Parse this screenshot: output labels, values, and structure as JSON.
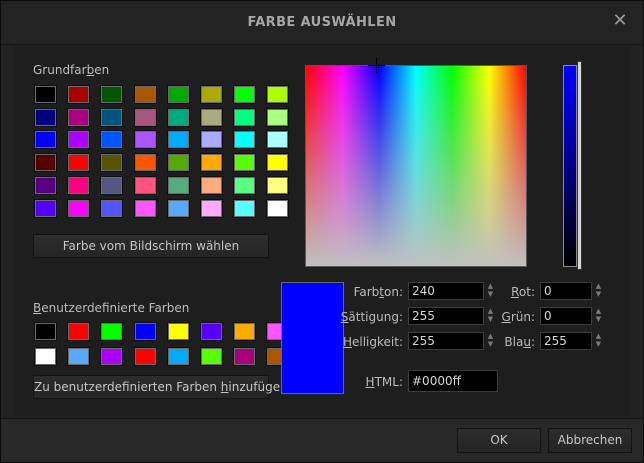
{
  "dialog": {
    "title": "FARBE AUSWÄHLEN",
    "close_symbol": "✕"
  },
  "basic_colors": {
    "label_before": "Grundfar",
    "label_underlined": "b",
    "label_after": "en",
    "swatches": [
      [
        "#000000",
        "#aa0000",
        "#005500",
        "#aa5500",
        "#00aa00",
        "#aaaa00",
        "#00ff00",
        "#aaff00"
      ],
      [
        "#00007f",
        "#aa007f",
        "#00557f",
        "#aa557f",
        "#00aa7f",
        "#aaaa7f",
        "#00ff7f",
        "#aaff7f"
      ],
      [
        "#0000ff",
        "#aa00ff",
        "#0055ff",
        "#aa55ff",
        "#00aaff",
        "#aaaaff",
        "#00ffff",
        "#aaffff"
      ],
      [
        "#550000",
        "#ff0000",
        "#555500",
        "#ff5500",
        "#55aa00",
        "#ffaa00",
        "#55ff00",
        "#ffff00"
      ],
      [
        "#55007f",
        "#ff007f",
        "#55557f",
        "#ff557f",
        "#55aa7f",
        "#ffaa7f",
        "#55ff7f",
        "#ffff7f"
      ],
      [
        "#5500ff",
        "#ff00ff",
        "#5555ff",
        "#ff55ff",
        "#55aaff",
        "#ffaaff",
        "#55ffff",
        "#ffffff"
      ]
    ]
  },
  "pick_screen_button": "Farbe vom Bildschirm wählen",
  "custom_colors": {
    "label_underlined": "B",
    "label_after": "enutzerdefinierte Farben",
    "swatches": [
      [
        "#000000",
        "#ff0000",
        "#00ff00",
        "#0000ff",
        "#ffff00",
        "#5500ff",
        "#ffaa00",
        "#ff55ff"
      ],
      [
        "#ffffff",
        "#55aaff",
        "#aa00ff",
        "#ff0000",
        "#00aaff",
        "#55ff00",
        "#aa007f",
        "#aa5500"
      ]
    ]
  },
  "add_custom_button": {
    "before": "Zu benutzerdefinierten Farben ",
    "underlined": "h",
    "after": "inzufügen"
  },
  "current_color": "#0000ff",
  "fields": {
    "hue": {
      "before": "Farb",
      "underlined": "t",
      "after": "on:",
      "value": "240"
    },
    "sat": {
      "before": "",
      "underlined": "S",
      "after": "ättigung:",
      "value": "255"
    },
    "val": {
      "before": "",
      "underlined": "H",
      "after": "elligkeit:",
      "value": "255"
    },
    "red": {
      "before": "",
      "underlined": "R",
      "after": "ot:",
      "value": "0"
    },
    "green": {
      "before": "",
      "underlined": "G",
      "after": "rün:",
      "value": "0"
    },
    "blue": {
      "before": "Bla",
      "underlined": "u",
      "after": ":",
      "value": "255"
    },
    "html": {
      "before": "",
      "underlined": "H",
      "after": "TML:",
      "value": "#0000ff"
    }
  },
  "spin_up": "▲",
  "spin_down": "▼",
  "buttons": {
    "ok": "OK",
    "cancel": "Abbrechen"
  }
}
